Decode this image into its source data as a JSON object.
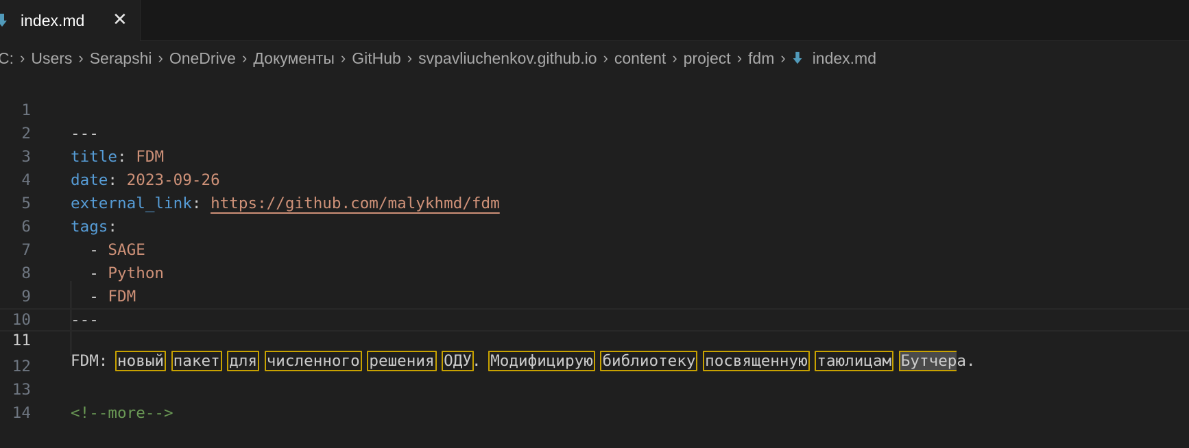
{
  "tab": {
    "label": "index.md",
    "close_glyph": "✕",
    "icon": "markdown-down-arrow-icon",
    "icon_color": "#519aba"
  },
  "breadcrumb": [
    "C:",
    "Users",
    "Serapshi",
    "OneDrive",
    "Документы",
    "GitHub",
    "svpavliuchenkov.github.io",
    "content",
    "project",
    "fdm"
  ],
  "breadcrumb_file": "index.md",
  "lines": {
    "l1": "---",
    "l2k": "title",
    "l2v": "FDM",
    "l3k": "date",
    "l3v": "2023-09-26",
    "l4k": "external_link",
    "l4v": "https://github.com/malykhmd/fdm",
    "l5k": "tags",
    "l6": "SAGE",
    "l7": "Python",
    "l8": "FDM",
    "l9": "---",
    "l11_prefix": "FDM:",
    "l11_words": [
      "новый",
      "пакет",
      "для",
      "численного",
      "решения",
      "ОДУ"
    ],
    "l11_words2": [
      "Модифицирую",
      "библиотеку",
      "посвященную",
      "таюлицам"
    ],
    "l11_last": "Бутчер",
    "l11_last_tail": "а",
    "l11_end": ".",
    "l13": "<!--more-->"
  },
  "line_numbers": [
    "1",
    "2",
    "3",
    "4",
    "5",
    "6",
    "7",
    "8",
    "9",
    "10",
    "11",
    "12",
    "13",
    "14"
  ],
  "colors": {
    "key": "#569cd6",
    "string": "#ce9178",
    "comment": "#6a9955",
    "highlight_border": "#c8a200"
  }
}
